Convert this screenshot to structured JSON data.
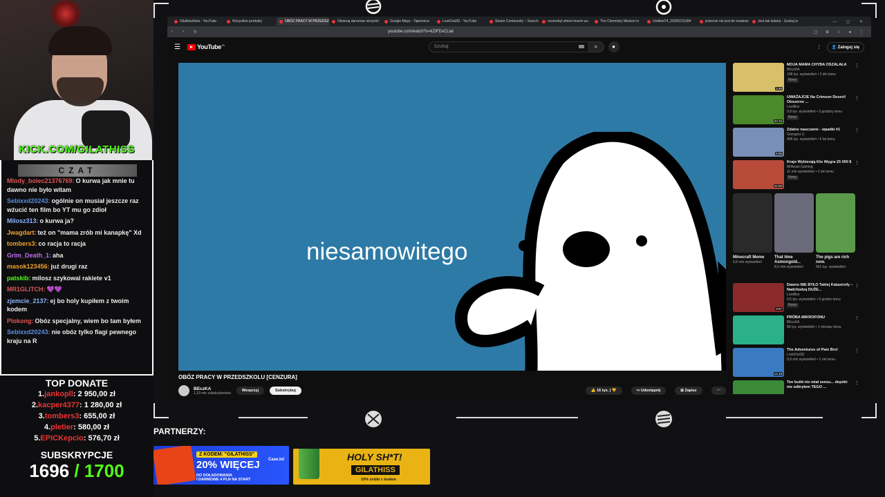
{
  "stream": {
    "kick_url": "KICK.COM/GILATHISS",
    "chat_header": "CZAT",
    "chat": [
      {
        "user": "Mlody_boiec21376769:",
        "text": "O kurwa jak mnie tu dawno nie było witam",
        "color": "#e05555"
      },
      {
        "user": "Sebixxd20243:",
        "text": "ogólnie on musiał jeszcze raz wżucić ten film bo YT mu go zdioł",
        "color": "#5b8fe0"
      },
      {
        "user": "Milosz313:",
        "text": "o kurwa ja?",
        "color": "#8ab4ff"
      },
      {
        "user": "Jwagdart:",
        "text": "też on \"mama zrób mi kanapkę\" Xd",
        "color": "#f0a030"
      },
      {
        "user": "tombers3:",
        "text": "co racja to racja",
        "color": "#f0a030"
      },
      {
        "user": "Grim_Death_1:",
        "text": "aha",
        "color": "#c06cf0"
      },
      {
        "user": "masok123456:",
        "text": "już drugi raz",
        "color": "#f0a030"
      },
      {
        "user": "patskib:",
        "text": "milosz szykowal rakiete v1",
        "color": "#53fc18"
      },
      {
        "user": "MR1GLITCH:",
        "text": "💜💜",
        "color": "#e05555"
      },
      {
        "user": "zjemcie_2137:",
        "text": "ej bo holy kupiłem z twoim kodem",
        "color": "#8ab4ff"
      },
      {
        "user": "Plokong:",
        "text": "Obóz specjalny, wiem bo tam byłem",
        "color": "#e05555"
      },
      {
        "user": "Sebixxd20243:",
        "text": "nie obóz tylko flagi pewnego kraju na R",
        "color": "#5b8fe0"
      }
    ],
    "top_donate_title": "TOP DONATE",
    "donates": [
      {
        "rank": "1.",
        "name": "jankopll",
        "amount": ": 2 950,00 zł"
      },
      {
        "rank": "2.",
        "name": "kacper4377",
        "amount": ": 1 280,00 zł"
      },
      {
        "rank": "3.",
        "name": "tombers3",
        "amount": ": 655,00 zł"
      },
      {
        "rank": "4.",
        "name": "pletier",
        "amount": ": 580,00 zł"
      },
      {
        "rank": "5.",
        "name": "EPICKepcio",
        "amount": ": 576,70 zł"
      }
    ],
    "subs_title": "SUBSKRYPCJE",
    "subs_current": "1696",
    "subs_goal": "/ 1700",
    "partners_label": "PARTNERZY:",
    "banner1": {
      "code": "Z KODEM: \"GILATHISS\"",
      "big": "20% WIĘCEJ",
      "line2": "DO DOŁADOWANIA",
      "small": "I DARMOWE 4 PLN NA START",
      "brand": "Case.lol"
    },
    "banner2": {
      "headline": "HOLY SH*T!",
      "code": "GILATHISS",
      "note": "10% zniżki z kodem"
    }
  },
  "browser": {
    "tabs": [
      "GilathissNew - YouTube",
      "Wszystkie produkty",
      "OBÓZ PRACY W PRZEDSZKOLU",
      "Otwieraj darmowe skrzynki",
      "Google Maps - Tajemnica",
      "LookOut3D - YouTube",
      "Steam Community :: Search",
      "cosmobyt wheel moem wu",
      "The Chemistry Mission in",
      "Untitled74_20260211084",
      "jedzenie nie jest do smakow",
      "Jest tak bułeka - Szukaj w"
    ],
    "active_tab": 2,
    "url": "youtube.com/watch?v=kZIFDvCLlal"
  },
  "youtube": {
    "logo": "YouTube",
    "logo_suffix": "PL",
    "search_placeholder": "Szukaj",
    "login": "Zaloguj się",
    "video_caption": "niesamowitego",
    "video_title": "OBÓZ PRACY W PRZEDSZKOLU [CENZURA]",
    "channel": "BEczKA",
    "channel_subs": "1,19 mln subskrybentów",
    "support": "Wesprzyj",
    "subscribe": "Subskrybuj",
    "likes": "16 tys.",
    "share": "Udostępnij",
    "save": "Zapisz",
    "recs_top": [
      {
        "title": "MOJA MAMA CHYBA OSZALAŁA",
        "channel": "BEczKA",
        "views": "108 tys. wyświetleń • 2 dni temu",
        "badge": "Nowy",
        "dur": "2:49",
        "color": "#d8c06a"
      },
      {
        "title": "UWAŻAJCIE Na Crimson Desert! Obszerne ...",
        "channel": "LootBox",
        "views": "9,8 tys. wyświetleń • 3 godziny temu",
        "badge": "Nowy",
        "dur": "20:19",
        "color": "#4a8a2a"
      },
      {
        "title": "Zdalne nauczanie - wpadki #1",
        "channel": "Grzegorz Z.",
        "views": "499 tys. wyświetleń • 5 lat temu",
        "badge": "",
        "dur": "5:05",
        "color": "#7a8fb8"
      },
      {
        "title": "Krajo Wybierają Kto Wygra 25 000 $",
        "channel": "MrBeast Gaming",
        "views": "11 mln wyświetleń • 2 dni temu",
        "badge": "Nowy",
        "dur": "22:09",
        "color": "#b84a3a"
      }
    ],
    "shorts": [
      {
        "title": "Minecraft Meme",
        "views": "9,8 mln wyświetleń",
        "color": "#2a2a2a"
      },
      {
        "title": "That time Asmongold...",
        "views": "8,5 mln wyświetleń",
        "color": "#6a6a7a"
      },
      {
        "title": "The pigs are rich now.",
        "views": "661 tys. wyświetleń",
        "color": "#5a9a4a"
      }
    ],
    "recs_bottom": [
      {
        "title": "Dawno NIE BYŁO Takiej Katastrofy – Nadchodzą DUŻE...",
        "channel": "LootBox",
        "views": "9,5 tys. wyświetleń • 5 godzin temu",
        "badge": "Nowy",
        "dur": "9:57",
        "color": "#8a2a2a"
      },
      {
        "title": "PRÓBA MIKROFONU",
        "channel": "BEczKA",
        "views": "89 tys. wyświetleń • 1 miesiąc temu",
        "badge": "",
        "dur": "",
        "color": "#2ab08a"
      },
      {
        "title": "The Adventures of Pain Bro!",
        "channel": "LookOut3D",
        "views": "9,9 mln wyświetleń • 1 rok temu",
        "badge": "",
        "dur": "14:18",
        "color": "#3a7ac0"
      },
      {
        "title": "Ten build nie miał sensu... dopóki nie odkryłem TEGO ...",
        "channel": "",
        "views": "",
        "badge": "",
        "dur": "",
        "color": "#3a8a3a"
      }
    ]
  }
}
